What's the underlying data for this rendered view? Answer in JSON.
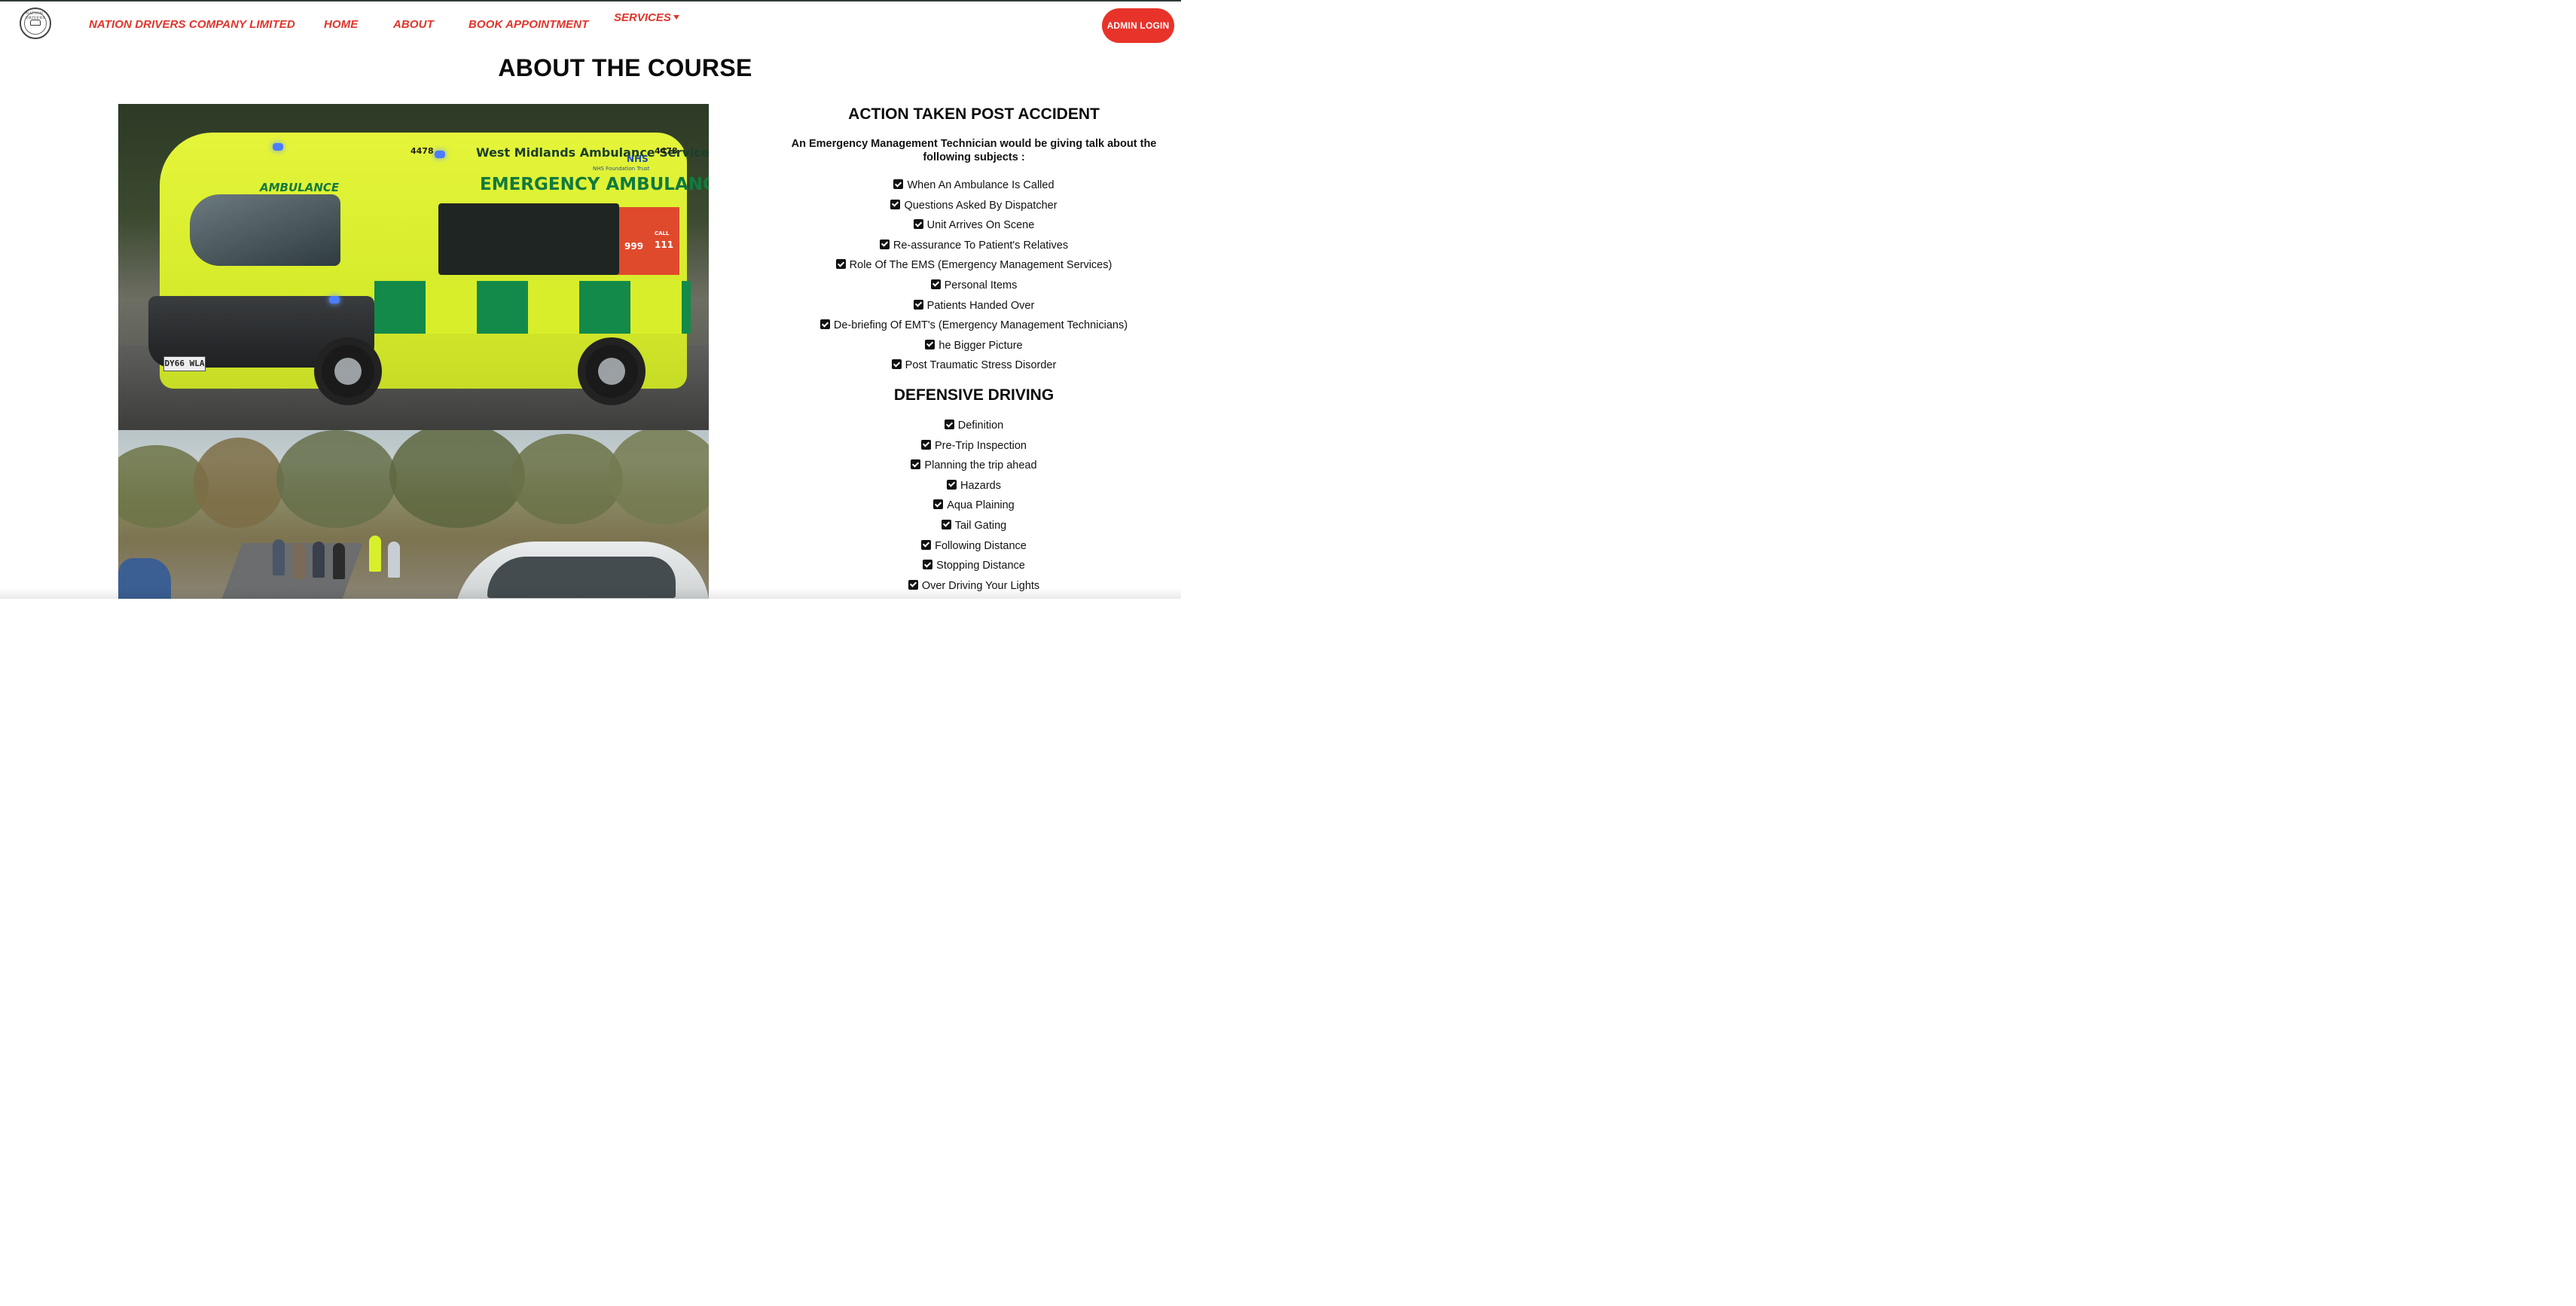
{
  "nav": {
    "brand": "NATION DRIVERS COMPANY LIMITED",
    "home": "HOME",
    "about": "ABOUT",
    "book": "BOOK APPOINTMENT",
    "services": "SERVICES",
    "admin": "ADMIN LOGIN",
    "logo_text": "NATION DRIVERS"
  },
  "page": {
    "title": "ABOUT THE COURSE"
  },
  "images": {
    "ambulance": {
      "fleet_number": "4478",
      "operator": "West Midlands Ambulance Service",
      "nhs": "NHS",
      "trust": "NHS Foundation Trust",
      "side_label": "EMERGENCY AMBULANCE",
      "front_label": "AMBULANCE",
      "plate": "DY66 WLA",
      "call_number": "999",
      "nonurgent_number": "111",
      "call_label": "CALL"
    }
  },
  "section1": {
    "title": "ACTION TAKEN POST ACCIDENT",
    "subtitle": "An Emergency Management Technician would be giving talk about the following subjects :",
    "items": [
      "When An Ambulance Is Called",
      "Questions Asked By Dispatcher",
      "Unit Arrives On Scene",
      "Re-assurance To Patient's Relatives",
      "Role Of The EMS (Emergency Management Services)",
      "Personal Items",
      "Patients Handed Over",
      "De-briefing Of EMT's (Emergency Management Technicians)",
      "he Bigger Picture",
      "Post Traumatic Stress Disorder"
    ]
  },
  "section2": {
    "title": "DEFENSIVE DRIVING",
    "items": [
      "Definition",
      "Pre-Trip Inspection",
      "Planning the trip ahead",
      "Hazards",
      "Aqua Plaining",
      "Tail Gating",
      "Following Distance",
      "Stopping Distance",
      "Over Driving Your Lights"
    ]
  },
  "icons": {
    "checkbox": "check-square-icon",
    "dropdown": "caret-down-icon"
  },
  "colors": {
    "accent": "#e0352b",
    "admin_button": "#e8332a",
    "text": "#111111"
  }
}
